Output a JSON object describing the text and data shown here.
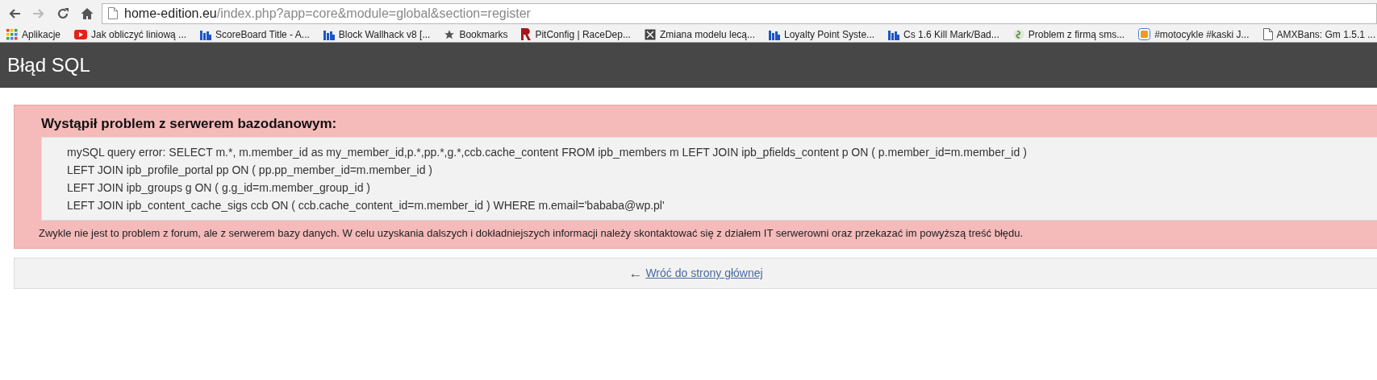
{
  "browser": {
    "back_enabled": true,
    "forward_enabled": false,
    "url": {
      "host": "home-edition.eu",
      "path": "/index.php?app=core&module=global&section=register"
    }
  },
  "bookmarks": [
    {
      "kind": "apps",
      "label": "Aplikacje"
    },
    {
      "kind": "video",
      "label": "Jak obliczyć liniową ..."
    },
    {
      "kind": "chart",
      "label": "ScoreBoard Title - A..."
    },
    {
      "kind": "chart",
      "label": "Block Wallhack v8 [..."
    },
    {
      "kind": "star",
      "label": "Bookmarks"
    },
    {
      "kind": "letter",
      "label": "PitConfig | RaceDep..."
    },
    {
      "kind": "cross",
      "label": "Zmiana modelu lecą..."
    },
    {
      "kind": "chart",
      "label": "Loyalty Point Syste..."
    },
    {
      "kind": "chart",
      "label": "Cs 1.6 Kill Mark/Bad..."
    },
    {
      "kind": "swirl",
      "label": "Problem z firmą sms..."
    },
    {
      "kind": "tile",
      "label": "#motocykle #kaski J..."
    },
    {
      "kind": "page",
      "label": "AMXBans: Gm 1.5.1 ..."
    }
  ],
  "header": {
    "title": "Błąd SQL"
  },
  "error": {
    "heading": "Wystąpił problem z serwerem bazodanowym:",
    "query_lines": [
      "mySQL query error: SELECT m.*, m.member_id as my_member_id,p.*,pp.*,g.*,ccb.cache_content FROM ipb_members m LEFT JOIN ipb_pfields_content p ON ( p.member_id=m.member_id )",
      "LEFT JOIN ipb_profile_portal pp ON ( pp.pp_member_id=m.member_id )",
      "LEFT JOIN ipb_groups g ON ( g.g_id=m.member_group_id )",
      "LEFT JOIN ipb_content_cache_sigs ccb ON ( ccb.cache_content_id=m.member_id ) WHERE m.email='bababa@wp.pl'"
    ],
    "note": "Zwykle nie jest to problem z forum, ale z serwerem bazy danych. W celu uzyskania dalszych i dokładniejszych informacji należy skontaktować się z działem IT serwerowni oraz przekazać im powyższą treść błędu."
  },
  "back_link": {
    "arrow": "←",
    "label": "Wróć do strony głównej"
  }
}
